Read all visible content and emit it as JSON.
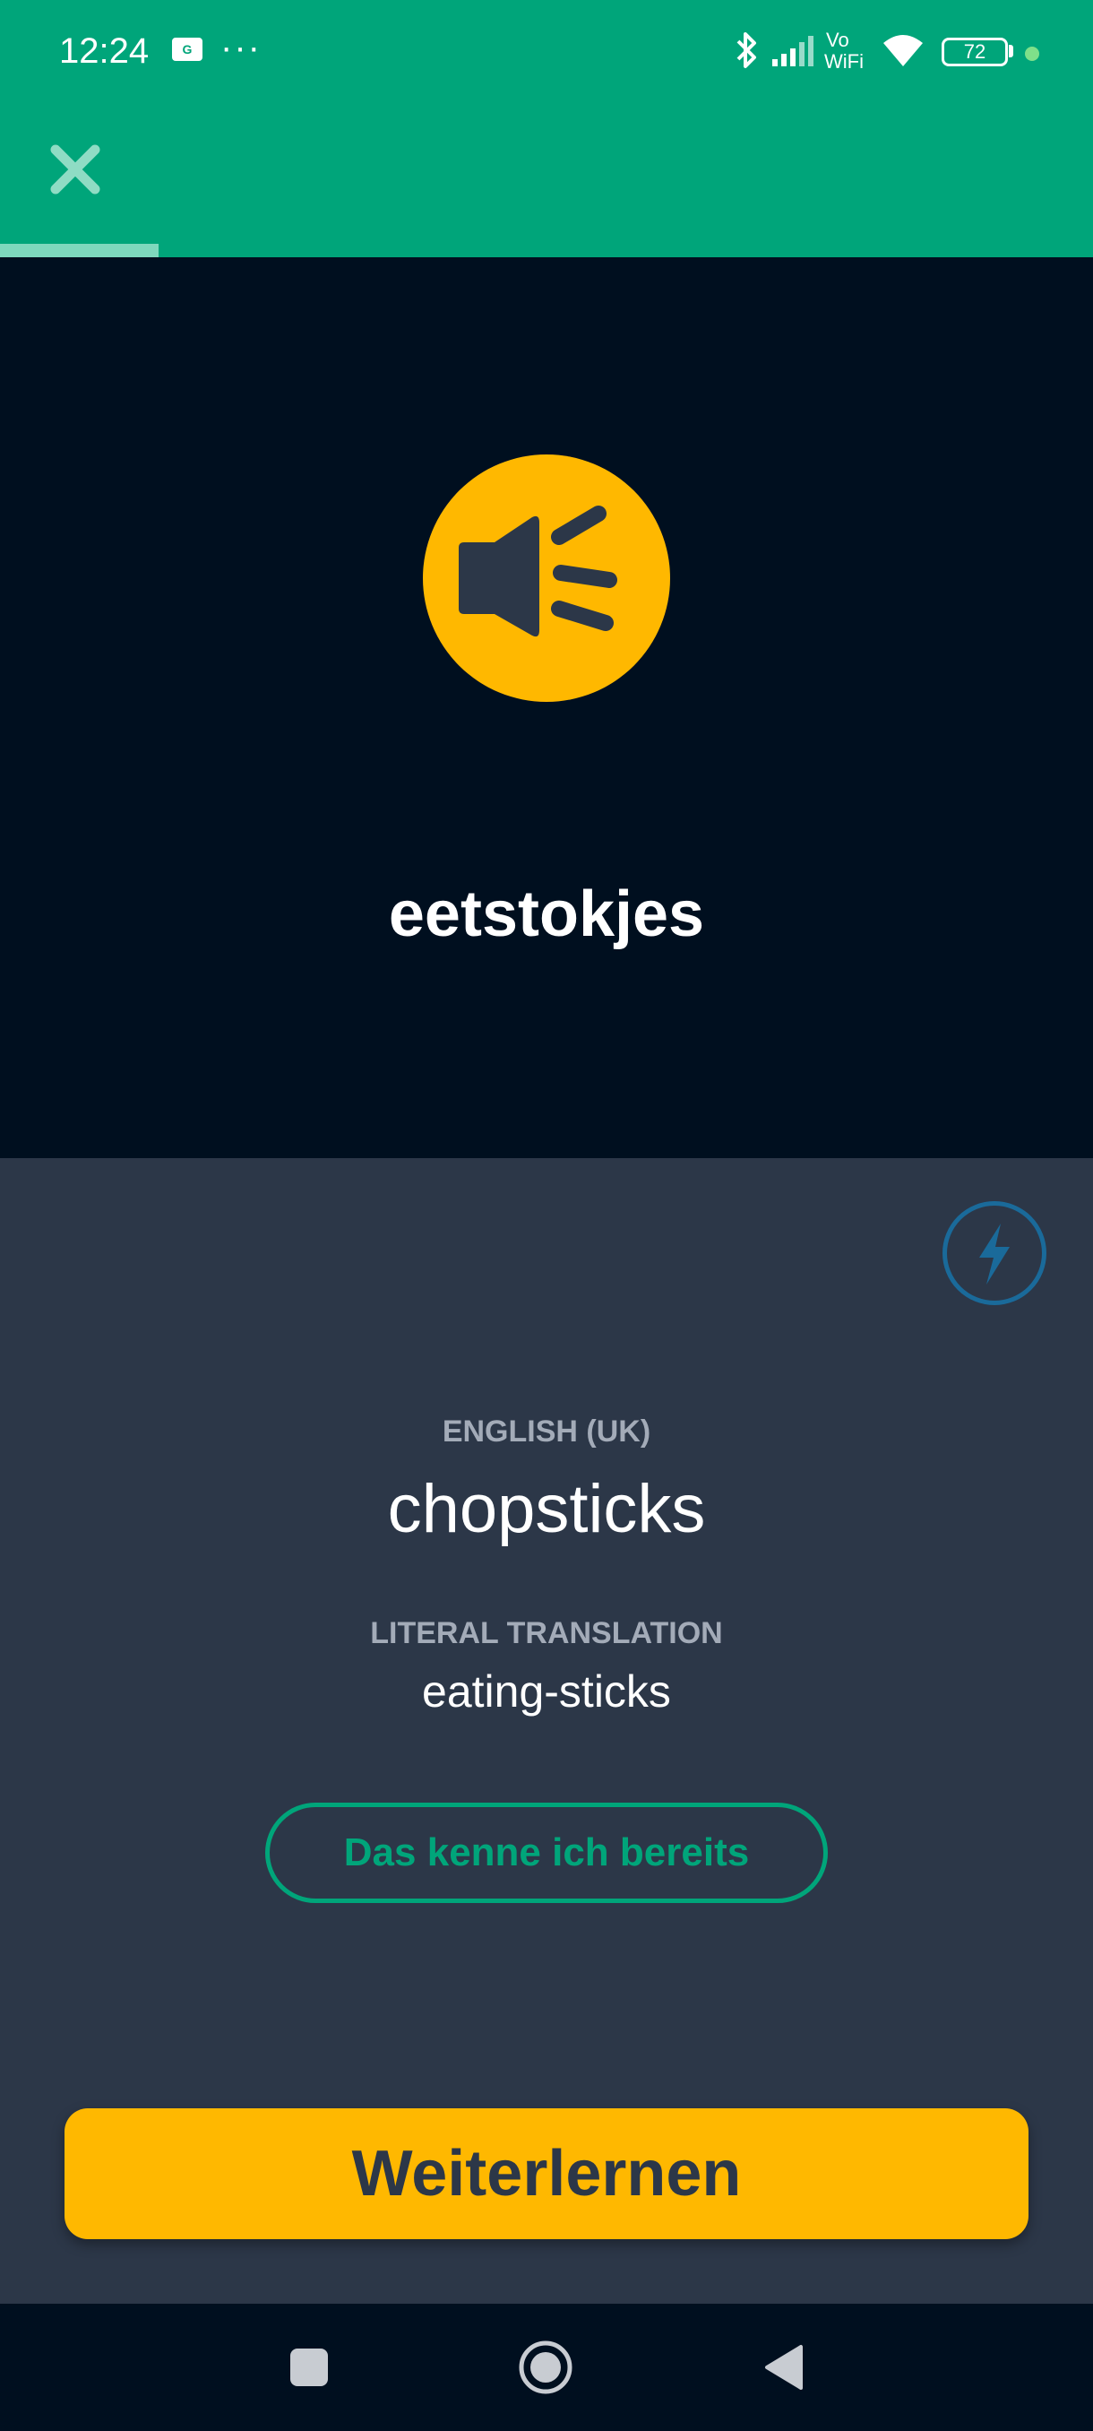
{
  "status_bar": {
    "time": "12:24",
    "notification_icon": "ge-notification-icon",
    "more": "···",
    "battery": "72",
    "wifi_label_top": "Vo",
    "wifi_label_bottom": "WiFi"
  },
  "header": {
    "close_icon": "close-icon",
    "progress": 0.145
  },
  "word_card": {
    "speaker_icon": "speaker-icon",
    "word": "eetstokjes"
  },
  "answer_card": {
    "flash_icon": "lightning-icon",
    "language_label": "ENGLISH (UK)",
    "translation": "chopsticks",
    "literal_label": "LITERAL TRANSLATION",
    "literal_translation": "eating-sticks",
    "already_know_button": "Das kenne ich bereits",
    "continue_button": "Weiterlernen"
  },
  "nav": {
    "recents": "square-icon",
    "home": "circle-icon",
    "back": "triangle-back-icon"
  },
  "colors": {
    "green": "#00a57a",
    "yellow": "#ffb800",
    "dark": "#000f1f",
    "panel": "#2c3748"
  }
}
